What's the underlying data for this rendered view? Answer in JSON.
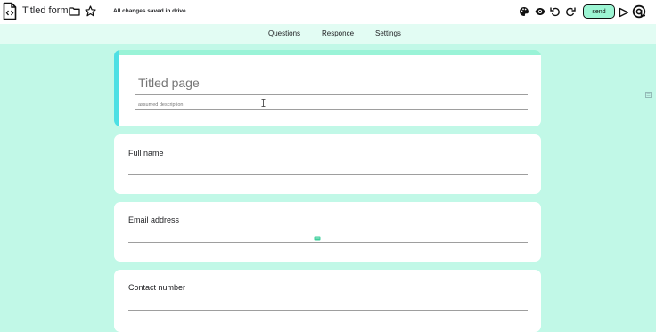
{
  "header": {
    "form_title": "Titled form",
    "save_status": "All changes saved in drive",
    "send_label": "send",
    "icons": [
      "form-doc-icon",
      "folder-icon",
      "star-icon",
      "palette-icon",
      "eye-icon",
      "undo-icon",
      "redo-icon",
      "send-arrow-icon",
      "logo-icon"
    ]
  },
  "tabs": [
    {
      "label": "Questions"
    },
    {
      "label": "Responce"
    },
    {
      "label": "Settings"
    }
  ],
  "title_card": {
    "title": "Titled page",
    "description": "assumed description"
  },
  "questions": [
    {
      "label": "Full name"
    },
    {
      "label": "Email address"
    },
    {
      "label": "Contact number"
    }
  ],
  "colors": {
    "background": "#c1f8e7",
    "tabbar": "#e2fcf3",
    "accent_strip": "#4de0e4",
    "top_strip": "#9af3d7",
    "send_button": "#9cf5d3"
  }
}
